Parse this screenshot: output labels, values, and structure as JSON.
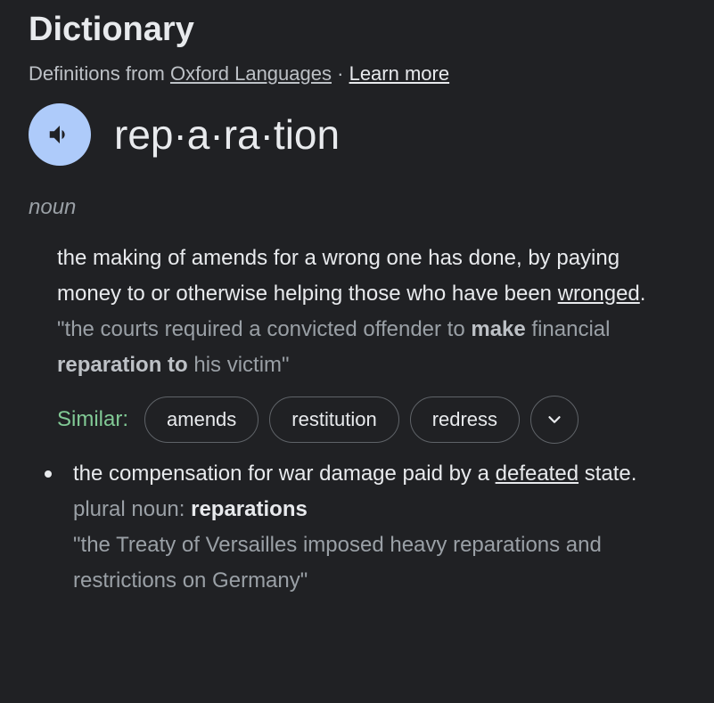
{
  "header": {
    "title": "Dictionary",
    "source_prefix": "Definitions from",
    "source_link": "Oxford Languages",
    "separator": "·",
    "learn_more": "Learn more"
  },
  "entry": {
    "headword": "rep·a·ra·tion",
    "pos": "noun",
    "senses": [
      {
        "definition_pre": "the making of amends for a wrong one has done, by paying money to or otherwise helping those who have been ",
        "definition_link": "wronged",
        "definition_post": ".",
        "example": {
          "q_open": "\"the courts required a convicted offender to ",
          "bold1": "make",
          "mid": " financial ",
          "bold2": "reparation to",
          "end": " his victim\""
        },
        "similar_label": "Similar:",
        "similar": [
          "amends",
          "restitution",
          "redress"
        ]
      },
      {
        "definition_pre": "the compensation for war damage paid by a ",
        "definition_link": "defeated",
        "definition_post": " state.",
        "plural_label": "plural noun:",
        "plural_form": "reparations",
        "example": "\"the Treaty of Versailles imposed heavy reparations and restrictions on Germany\""
      }
    ]
  },
  "colors": {
    "background": "#202124",
    "text": "#e8eaed",
    "muted": "#9aa0a6",
    "similar_green": "#81c995",
    "speaker_blue": "#aecbfa"
  },
  "icons": {
    "speaker": "speaker-icon",
    "expand": "chevron-down-icon"
  }
}
